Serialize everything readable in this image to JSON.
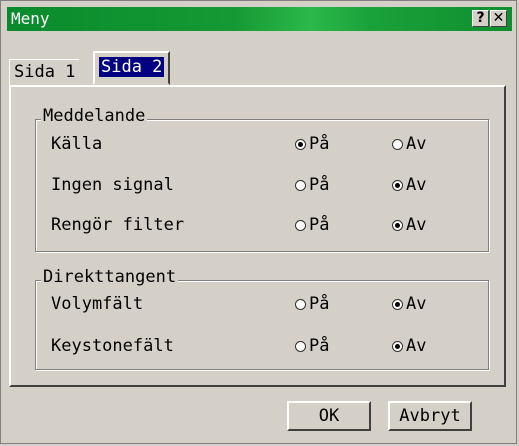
{
  "window": {
    "title": "Meny",
    "help_label": "?",
    "close_label": "✕"
  },
  "tabs": [
    {
      "label": "Sida 1"
    },
    {
      "label": "Sida 2"
    }
  ],
  "groups": [
    {
      "legend": "Meddelande",
      "rows": [
        {
          "label": "Källa",
          "on": "På",
          "off": "Av",
          "selected": "on"
        },
        {
          "label": "Ingen signal",
          "on": "På",
          "off": "Av",
          "selected": "off"
        },
        {
          "label": "Rengör filter",
          "on": "På",
          "off": "Av",
          "selected": "off"
        }
      ]
    },
    {
      "legend": "Direkttangent",
      "rows": [
        {
          "label": "Volymfält",
          "on": "På",
          "off": "Av",
          "selected": "off"
        },
        {
          "label": "Keystonefält",
          "on": "På",
          "off": "Av",
          "selected": "off"
        }
      ]
    }
  ],
  "buttons": {
    "ok": "OK",
    "cancel": "Avbryt"
  },
  "colors": {
    "titlebar": "#149a34",
    "face": "#d4d0c8",
    "tab_selected": "#000080"
  }
}
